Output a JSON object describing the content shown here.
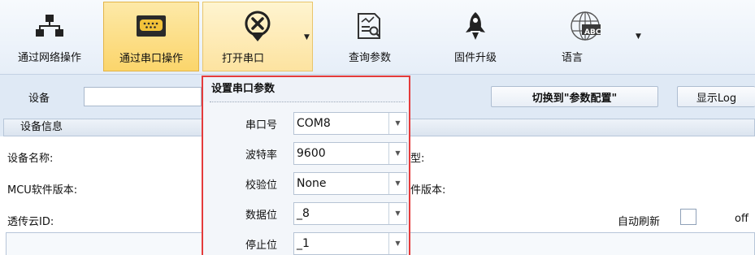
{
  "ribbon": {
    "network": {
      "label": "通过网络操作",
      "icon": "network-icon"
    },
    "serial": {
      "label": "通过串口操作",
      "icon": "serial-port-icon"
    },
    "open_port": {
      "label": "打开串口",
      "icon": "close-circle-pin-icon"
    },
    "query": {
      "label": "查询参数",
      "icon": "query-document-icon"
    },
    "firmware": {
      "label": "固件升级",
      "icon": "rocket-icon"
    },
    "language": {
      "label": "语言",
      "icon": "globe-abc-icon",
      "badge": "ABC"
    }
  },
  "toolbar": {
    "device_label": "设备",
    "device_value": "",
    "switch_label": "切换到\"参数配置\"",
    "log_label": "显示Log"
  },
  "device_info": {
    "header": "设备信息",
    "name_label": "设备名称:",
    "mcu_label": "MCU软件版本:",
    "cloud_label": "透传云ID:",
    "type_label_partial": "型:",
    "hw_label_partial": "件版本:",
    "auto_refresh_label": "自动刷新",
    "auto_refresh_state": "off"
  },
  "serial_popup": {
    "title": "设置串口参数",
    "fields": [
      {
        "label": "串口号",
        "value": "COM8"
      },
      {
        "label": "波特率",
        "value": "9600"
      },
      {
        "label": "校验位",
        "value": "None"
      },
      {
        "label": "数据位",
        "value": "_8"
      },
      {
        "label": "停止位",
        "value": "_1"
      }
    ]
  },
  "colors": {
    "accent_active": "#fbd56b",
    "popup_border": "#e43b3b",
    "background": "#dfe9f5"
  }
}
